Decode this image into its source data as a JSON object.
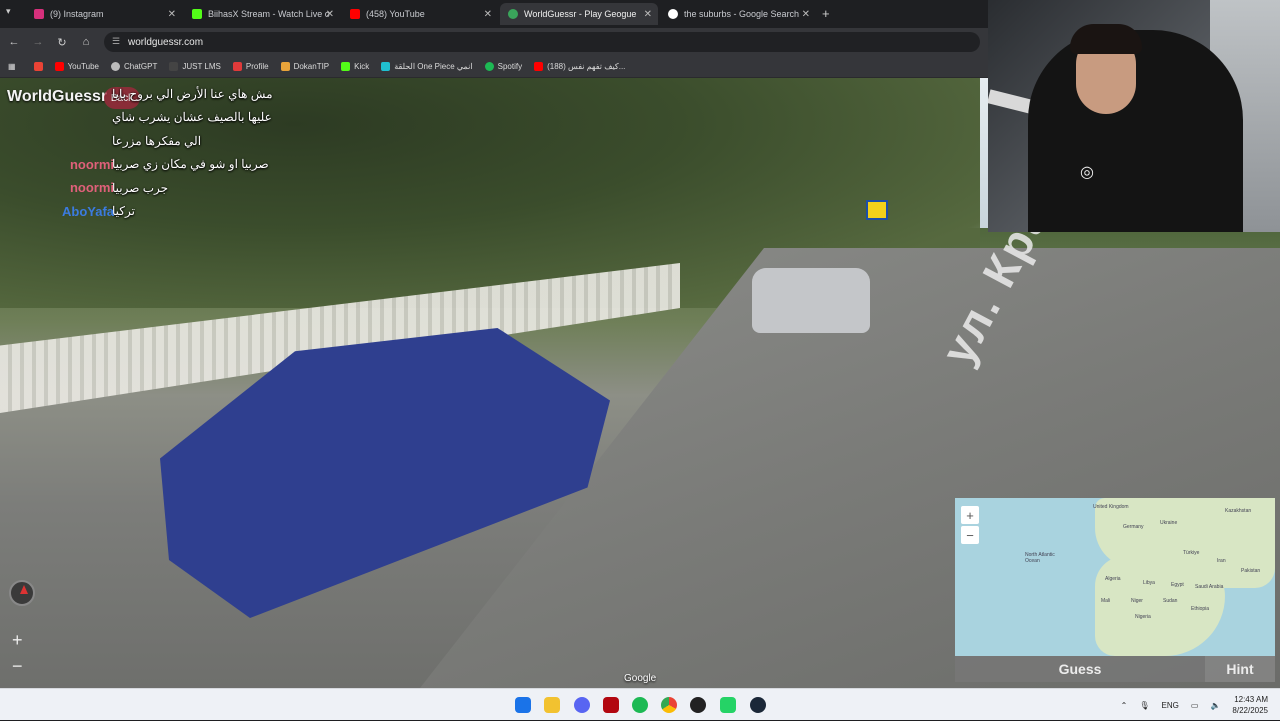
{
  "browser": {
    "tabs": [
      {
        "title": "(9) Instagram",
        "color": "#d6307c",
        "active": false
      },
      {
        "title": "BiihasX Stream - Watch Live on",
        "color": "#53fc18",
        "active": false
      },
      {
        "title": "(458) YouTube",
        "color": "#ff0000",
        "active": false
      },
      {
        "title": "WorldGuessr - Play Geoguessr",
        "color": "#3aa55b",
        "active": true
      },
      {
        "title": "the suburbs - Google Search",
        "color": "#ffffff",
        "active": false
      }
    ],
    "tab_close_glyph": "✕",
    "new_tab_glyph": "+",
    "url": "worldguessr.com",
    "bookmarks": [
      {
        "label": "",
        "icon": "gmail-icon",
        "color": "#ea4335"
      },
      {
        "label": "YouTube",
        "icon": "youtube-icon",
        "color": "#ff0000"
      },
      {
        "label": "ChatGPT",
        "icon": "chatgpt-icon",
        "color": "#bbbbbb"
      },
      {
        "label": "JUST LMS",
        "icon": "lms-icon",
        "color": "#444444"
      },
      {
        "label": "Profile",
        "icon": "profile-icon",
        "color": "#e03a3a"
      },
      {
        "label": "DokanTIP",
        "icon": "dokan-icon",
        "color": "#e8a33a"
      },
      {
        "label": "Kick",
        "icon": "kick-icon",
        "color": "#53fc18"
      },
      {
        "label": "الحلقة One Piece انمي",
        "icon": "anime-icon",
        "color": "#20c0d0"
      },
      {
        "label": "Spotify",
        "icon": "spotify-icon",
        "color": "#1db954"
      },
      {
        "label": "(188) كيف تفهم نفس...",
        "icon": "youtube-icon",
        "color": "#ff0000"
      }
    ]
  },
  "game": {
    "logo": "WorldGuessr",
    "back_label": "Back",
    "street_sign_text": "ул. Красная",
    "watermark": "Google",
    "guess_label": "Guess",
    "hint_label": "Hint",
    "zoom_in": "+",
    "zoom_out": "−",
    "map_zoom_in": "+",
    "map_zoom_out": "−",
    "map_labels": [
      "United Kingdom",
      "Germany",
      "Ukraine",
      "Kazakhstan",
      "North Atlantic Ocean",
      "Algeria",
      "Libya",
      "Egypt",
      "Mali",
      "Niger",
      "Sudan",
      "Nigeria",
      "Türkiye",
      "Iran",
      "Pakistan",
      "Saudi Arabia",
      "Ethiopia"
    ]
  },
  "chat": [
    {
      "user": "",
      "color": "#e04a4a",
      "text": "مش هاي عنا الأرض الي بروح بابا"
    },
    {
      "user": "",
      "color": "#e04a4a",
      "text": "عليها بالصيف عشان يشرب شاي"
    },
    {
      "user": "",
      "color": "#e04a4a",
      "text": "الي مفكرها مزرعا"
    },
    {
      "user": "noormi",
      "color": "#e0607a",
      "text": "صربيا او شو في مكان زي صربيا"
    },
    {
      "user": "noormi",
      "color": "#e0607a",
      "text": "جرب صربيا"
    },
    {
      "user": "AboYafa",
      "color": "#3b7be0",
      "text": "تركيا"
    }
  ],
  "taskbar": {
    "apps": [
      "windows-start-icon",
      "file-explorer-icon",
      "discord-icon",
      "netflix-icon",
      "spotify-icon",
      "chrome-icon",
      "obs-icon",
      "whatsapp-icon",
      "steam-icon"
    ],
    "language": "ENG",
    "time": "12:43 AM",
    "date": "8/22/2025"
  }
}
